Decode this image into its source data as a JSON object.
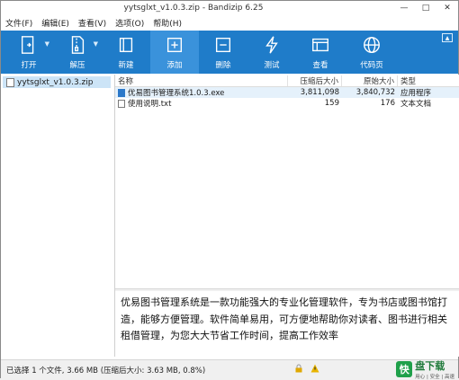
{
  "window": {
    "title": "yytsglxt_v1.0.3.zip - Bandizip 6.25",
    "minimize": "—",
    "maximize": "□",
    "close": "✕"
  },
  "menu": [
    "文件(F)",
    "编辑(E)",
    "查看(V)",
    "选项(O)",
    "帮助(H)"
  ],
  "toolbar": {
    "accent": "#1f7cc9",
    "items": [
      {
        "label": "打开",
        "icon": "open-icon",
        "dropdown": true
      },
      {
        "label": "解压",
        "icon": "extract-icon",
        "dropdown": true
      },
      {
        "label": "新建",
        "icon": "new-archive-icon",
        "dropdown": false
      },
      {
        "label": "添加",
        "icon": "add-icon",
        "dropdown": false
      },
      {
        "label": "删除",
        "icon": "delete-icon",
        "dropdown": false
      },
      {
        "label": "测试",
        "icon": "test-icon",
        "dropdown": false
      },
      {
        "label": "查看",
        "icon": "view-icon",
        "dropdown": false
      },
      {
        "label": "代码页",
        "icon": "codepage-icon",
        "dropdown": false
      }
    ]
  },
  "tree": {
    "root": "yytsglxt_v1.0.3.zip"
  },
  "list": {
    "columns": [
      "名称",
      "压缩后大小",
      "原始大小",
      "类型"
    ],
    "rows": [
      {
        "name": "优易图书管理系统1.0.3.exe",
        "packed": "3,811,098",
        "size": "3,840,732",
        "type": "应用程序",
        "icon": "exe-icon"
      },
      {
        "name": "使用说明.txt",
        "packed": "159",
        "size": "176",
        "type": "文本文档",
        "icon": "txt-icon"
      }
    ]
  },
  "description": "优易图书管理系统是一款功能强大的专业化管理软件，专为书店或图书馆打造，能够方便管理。软件简单易用，可方便地帮助你对读者、图书进行相关租借管理，为您大大节省工作时间，提高工作效率",
  "status": {
    "text": "已选择 1 个文件, 3.66 MB (压缩后大小: 3.63 MB, 0.8%)"
  },
  "brand": {
    "badge": "快",
    "name": "盘下载",
    "tag": "用心 | 安全 | 高速"
  }
}
